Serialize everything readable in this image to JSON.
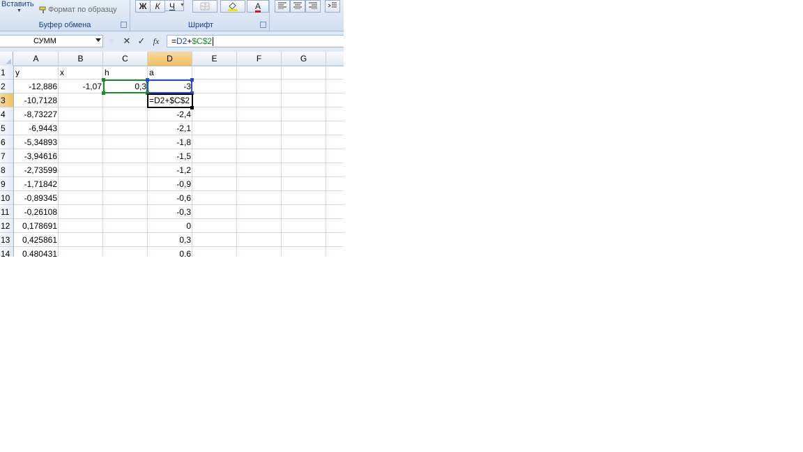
{
  "ribbon": {
    "paste_label": "Вставить",
    "format_painter_label": "Формат по образцу",
    "clipboard_group_title": "Буфер обмена",
    "font_group_title": "Шрифт",
    "bold_label": "Ж",
    "italic_label": "К",
    "underline_label": "Ч",
    "font_color_label": "А",
    "icons": [
      "format-painter-icon",
      "borders-icon",
      "fill-color-icon",
      "font-color-icon",
      "align-left-icon",
      "align-center-icon",
      "align-right-icon",
      "indent-icon"
    ]
  },
  "formula_bar": {
    "name_box": "СУММ",
    "cancel_symbol": "✕",
    "enter_symbol": "✓",
    "fx_label": "fx",
    "formula_prefix": "=",
    "formula_ref1": "D2",
    "formula_op": "+",
    "formula_ref2": "$C$2"
  },
  "grid": {
    "columns": [
      "A",
      "B",
      "C",
      "D",
      "E",
      "F",
      "G"
    ],
    "active_column": "D",
    "rows": [
      "1",
      "2",
      "3",
      "4",
      "5",
      "6",
      "7",
      "8",
      "9",
      "10",
      "11",
      "12",
      "13",
      "14"
    ],
    "active_row": "3",
    "headers": {
      "a": "y",
      "b": "x",
      "c": "h",
      "d": "a"
    },
    "b2": "-1,07",
    "c2": "0,3",
    "d2": "-3",
    "editing_cell_text": "=D2+$C$2",
    "col_a": [
      "-12,886",
      "-10,7128",
      "-8,73227",
      "-6,9443",
      "-5,34893",
      "-3,94616",
      "-2,73599",
      "-1,71842",
      "-0,89345",
      "-0,26108",
      "0,178691",
      "0,425861",
      "0,480431"
    ],
    "col_d": [
      "-2,4",
      "-2,1",
      "-1,8",
      "-1,5",
      "-1,2",
      "-0,9",
      "-0,6",
      "-0,3",
      "0",
      "0,3",
      "0,6"
    ]
  },
  "colors": {
    "ref_blue": "#2a4bd7",
    "ref_green": "#1f8a2a",
    "header_active": "#f1c15f",
    "ribbon_text": "#15428b"
  }
}
